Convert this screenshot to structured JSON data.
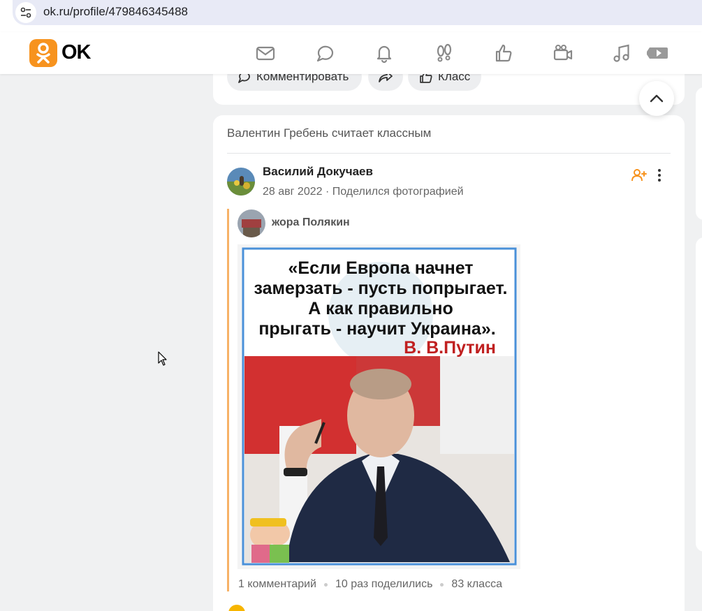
{
  "browser": {
    "url": "ok.ru/profile/479846345488"
  },
  "header": {
    "logo_text": "OK",
    "nav_icons": [
      "mail-icon",
      "chat-icon",
      "bell-icon",
      "guests-icon",
      "like-icon",
      "video-icon",
      "music-icon",
      "video-play-icon"
    ]
  },
  "prev_post_actions": {
    "comment_label": "Комментировать",
    "share_icon": "share-icon",
    "class_label": "Класс"
  },
  "feed_item": {
    "liked_by_text": "Валентин Гребень считает классным",
    "author_name": "Василий Докучаев",
    "date": "28 авг 2022",
    "action": "Поделился фотографией",
    "reshared_from": "жора Полякин",
    "image_caption_lines": [
      "«Если Европа начнет",
      "замерзать - пусть попрыгает.",
      "А как правильно",
      "прыгать - научит Украина».",
      "В. В.Путин"
    ],
    "stats": {
      "comments": "1 комментарий",
      "shares": "10 раз поделились",
      "classes": "83 класса"
    }
  },
  "colors": {
    "brand": "#f7931e",
    "accent_bar": "#f7b267",
    "page_bg": "#f0f1f2"
  }
}
